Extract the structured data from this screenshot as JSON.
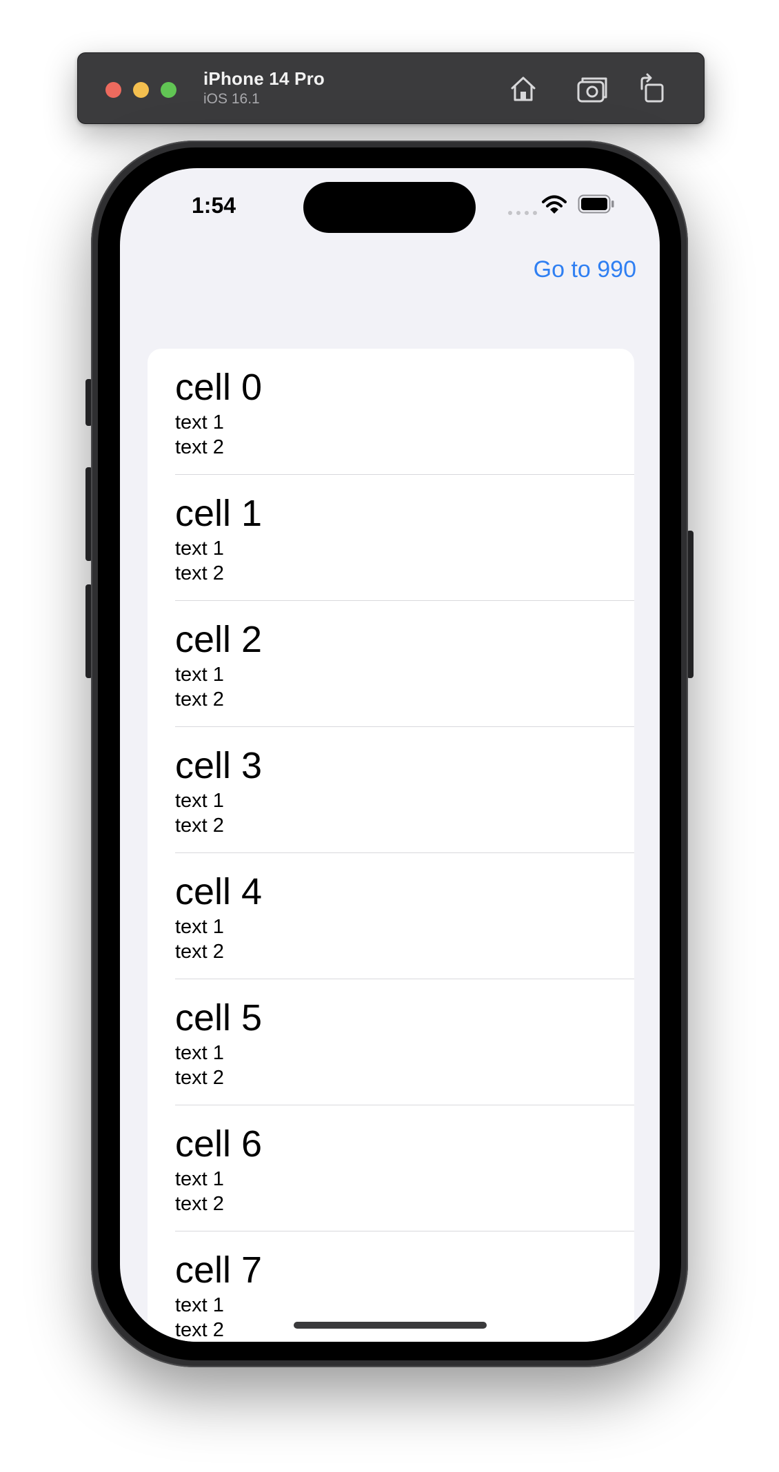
{
  "simulator": {
    "device_name": "iPhone 14 Pro",
    "os_version": "iOS 16.1",
    "buttons": [
      {
        "icon": "home-icon"
      },
      {
        "icon": "screenshot-icon"
      },
      {
        "icon": "rotate-icon"
      }
    ],
    "colors": {
      "close": "#ed6a5e",
      "minimize": "#f4bf4f",
      "zoom": "#61c554"
    }
  },
  "status_bar": {
    "time": "1:54",
    "icons": [
      "signal-icon",
      "wifi-icon",
      "battery-icon"
    ]
  },
  "nav": {
    "right_button_label": "Go to 990",
    "accent_color": "#2f7ff2"
  },
  "cells": [
    {
      "title": "cell 0",
      "line1": "text 1",
      "line2": "text 2"
    },
    {
      "title": "cell 1",
      "line1": "text 1",
      "line2": "text 2"
    },
    {
      "title": "cell 2",
      "line1": "text 1",
      "line2": "text 2"
    },
    {
      "title": "cell 3",
      "line1": "text 1",
      "line2": "text 2"
    },
    {
      "title": "cell 4",
      "line1": "text 1",
      "line2": "text 2"
    },
    {
      "title": "cell 5",
      "line1": "text 1",
      "line2": "text 2"
    },
    {
      "title": "cell 6",
      "line1": "text 1",
      "line2": "text 2"
    },
    {
      "title": "cell 7",
      "line1": "text 1",
      "line2": "text 2"
    }
  ]
}
